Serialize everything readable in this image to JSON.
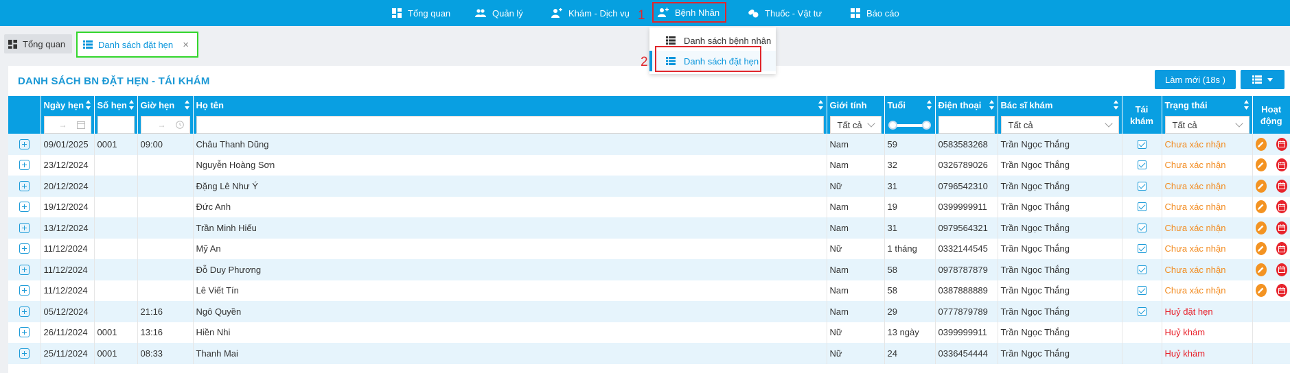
{
  "nav": {
    "items": [
      {
        "label": "Tổng quan",
        "icon": "dashboard-icon"
      },
      {
        "label": "Quản lý",
        "icon": "users-icon"
      },
      {
        "label": "Khám - Dịch vụ",
        "icon": "user-medical-icon"
      },
      {
        "label": "Bệnh Nhân",
        "icon": "patient-icon"
      },
      {
        "label": "Thuốc - Vật tư",
        "icon": "medicine-icon"
      },
      {
        "label": "Báo cáo",
        "icon": "report-icon"
      }
    ],
    "annotation_1": "1",
    "annotation_2": "2"
  },
  "tabs": {
    "home": "Tổng quan",
    "active": "Danh sách đặt hẹn",
    "close": "×"
  },
  "dropdown": {
    "items": [
      "Danh sách bệnh nhân",
      "Danh sách đặt hẹn"
    ]
  },
  "panel": {
    "title": "DANH SÁCH BN ĐẶT HẸN - TÁI KHÁM",
    "refresh_label": "Làm mới (18s )"
  },
  "table": {
    "headers": {
      "date": "Ngày hẹn",
      "num": "Số hẹn",
      "time": "Giờ hẹn",
      "name": "Họ tên",
      "gender": "Giới tính",
      "age": "Tuổi",
      "phone": "Điện thoại",
      "doctor": "Bác sĩ khám",
      "revisit": "Tái khám",
      "status": "Trạng thái",
      "actions": "Hoạt động"
    },
    "filters": {
      "range_arrow": "→",
      "gender": "Tất cả",
      "doctor": "Tất cả",
      "status": "Tất cả"
    },
    "rows": [
      {
        "date": "09/01/2025",
        "num": "0001",
        "time": "09:00",
        "name": "Châu Thanh Dũng",
        "gender": "Nam",
        "age": "59",
        "phone": "0583583268",
        "doctor": "Trần Ngọc Thắng",
        "revisit": true,
        "status": "Chưa xác nhận",
        "status_color": "orange",
        "actions": true
      },
      {
        "date": "23/12/2024",
        "num": "",
        "time": "",
        "name": "Nguyễn Hoàng Sơn",
        "gender": "Nam",
        "age": "32",
        "phone": "0326789026",
        "doctor": "Trần Ngọc Thắng",
        "revisit": true,
        "status": "Chưa xác nhận",
        "status_color": "orange",
        "actions": true
      },
      {
        "date": "20/12/2024",
        "num": "",
        "time": "",
        "name": "Đặng Lê Như Ý",
        "gender": "Nữ",
        "age": "31",
        "phone": "0796542310",
        "doctor": "Trần Ngọc Thắng",
        "revisit": true,
        "status": "Chưa xác nhận",
        "status_color": "orange",
        "actions": true
      },
      {
        "date": "19/12/2024",
        "num": "",
        "time": "",
        "name": "Đức Anh",
        "gender": "Nam",
        "age": "19",
        "phone": "0399999911",
        "doctor": "Trần Ngọc Thắng",
        "revisit": true,
        "status": "Chưa xác nhận",
        "status_color": "orange",
        "actions": true
      },
      {
        "date": "13/12/2024",
        "num": "",
        "time": "",
        "name": "Trần Minh Hiếu",
        "gender": "Nam",
        "age": "31",
        "phone": "0979564321",
        "doctor": "Trần Ngọc Thắng",
        "revisit": true,
        "status": "Chưa xác nhận",
        "status_color": "orange",
        "actions": true
      },
      {
        "date": "11/12/2024",
        "num": "",
        "time": "",
        "name": "Mỹ An",
        "gender": "Nữ",
        "age": "1 tháng",
        "phone": "0332144545",
        "doctor": "Trần Ngọc Thắng",
        "revisit": true,
        "status": "Chưa xác nhận",
        "status_color": "orange",
        "actions": true
      },
      {
        "date": "11/12/2024",
        "num": "",
        "time": "",
        "name": "Đỗ Duy Phương",
        "gender": "Nam",
        "age": "58",
        "phone": "0978787879",
        "doctor": "Trần Ngọc Thắng",
        "revisit": true,
        "status": "Chưa xác nhận",
        "status_color": "orange",
        "actions": true
      },
      {
        "date": "11/12/2024",
        "num": "",
        "time": "",
        "name": "Lê Viết Tín",
        "gender": "Nam",
        "age": "58",
        "phone": "0387888889",
        "doctor": "Trần Ngọc Thắng",
        "revisit": true,
        "status": "Chưa xác nhận",
        "status_color": "orange",
        "actions": true
      },
      {
        "date": "05/12/2024",
        "num": "",
        "time": "21:16",
        "name": "Ngô Quyền",
        "gender": "Nam",
        "age": "29",
        "phone": "0777879789",
        "doctor": "Trần Ngọc Thắng",
        "revisit": true,
        "status": "Huỷ đặt hẹn",
        "status_color": "red",
        "actions": false
      },
      {
        "date": "26/11/2024",
        "num": "0001",
        "time": "13:16",
        "name": "Hiền Nhi",
        "gender": "Nữ",
        "age": "13 ngày",
        "phone": "0399999911",
        "doctor": "Trần Ngọc Thắng",
        "revisit": false,
        "status": "Huỷ khám",
        "status_color": "red",
        "actions": false
      },
      {
        "date": "25/11/2024",
        "num": "0001",
        "time": "08:33",
        "name": "Thanh Mai",
        "gender": "Nữ",
        "age": "24",
        "phone": "0336454444",
        "doctor": "Trần Ngọc Thắng",
        "revisit": false,
        "status": "Huỷ khám",
        "status_color": "red",
        "actions": false
      }
    ]
  }
}
